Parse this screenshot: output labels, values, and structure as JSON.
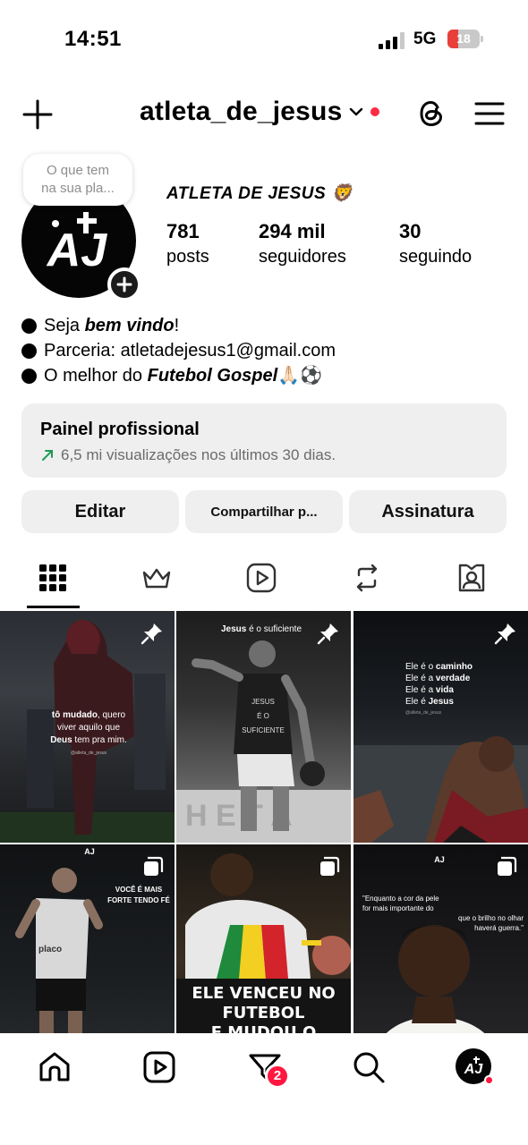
{
  "status_bar": {
    "time": "14:51",
    "network": "5G",
    "battery": "18"
  },
  "header": {
    "username": "atleta_de_jesus",
    "icons": [
      "plus-icon",
      "chevron-down-icon",
      "threads-icon",
      "hamburger-menu-icon"
    ]
  },
  "note": {
    "line1": "O que tem",
    "line2": "na sua pla..."
  },
  "profile": {
    "avatar_text": "AJ",
    "display_name": "ATLETA DE JESUS 🦁",
    "stats": [
      {
        "value": "781",
        "label": "posts"
      },
      {
        "value": "294 mil",
        "label": "seguidores"
      },
      {
        "value": "30",
        "label": "seguindo"
      }
    ]
  },
  "bio": {
    "line1_prefix": "Seja ",
    "line1_bold": "bem vindo",
    "line1_suffix": "!",
    "line2": "Parceria: atletadejesus1@gmail.com",
    "line3_prefix": "O melhor do ",
    "line3_bold": "Futebol Gospel",
    "line3_suffix": " 🙏🏻⚽"
  },
  "professional_panel": {
    "title": "Painel profissional",
    "subtitle": "6,5 mi visualizações nos últimos 30 dias."
  },
  "actions": {
    "edit": "Editar",
    "share": "Compartilhar p...",
    "subscription": "Assinatura"
  },
  "tabs": [
    "grid-icon",
    "crown-icon",
    "reels-icon",
    "repost-icon",
    "tagged-icon"
  ],
  "posts": [
    {
      "caption_a": "tô mudado",
      "caption_b": ", quero",
      "caption_c": "viver aquilo que",
      "caption_d": "Deus",
      "caption_e": " tem pra mim.",
      "handle": "@atleta_de_jesus",
      "pinned": true
    },
    {
      "caption_a": "Jesus",
      "caption_b": " é o suficiente",
      "shirt1": "JESUS",
      "shirt2": "É O",
      "shirt3": "SUFICIENTE",
      "pinned": true
    },
    {
      "l1a": "Ele é o ",
      "l1b": "caminho",
      "l2a": "Ele é a ",
      "l2b": "verdade",
      "l3a": "Ele é a ",
      "l3b": "vida",
      "l4a": "Ele é ",
      "l4b": "Jesus",
      "handle": "@atleta_de_jesus",
      "pinned": true
    },
    {
      "caption_a": "VOCÊ É MAIS",
      "caption_b": "FORTE TENDO FÉ",
      "logo": "AJ",
      "multi": true
    },
    {
      "caption_a": "ELE VENCEU NO FUTEBOL",
      "caption_b": "E MUDOU O DESTINO DE",
      "multi": true
    },
    {
      "caption_a": "\"Enquanto a cor da pele",
      "caption_b": "for mais importante do",
      "caption_c": "que o brilho no olhar",
      "caption_d": "haverá guerra.\"",
      "logo": "AJ",
      "multi": true
    }
  ],
  "bottom_nav": {
    "items": [
      "home-icon",
      "reels-icon",
      "activity-icon",
      "search-icon",
      "profile-avatar"
    ],
    "badge": "2",
    "avatar_text": "AJ"
  }
}
